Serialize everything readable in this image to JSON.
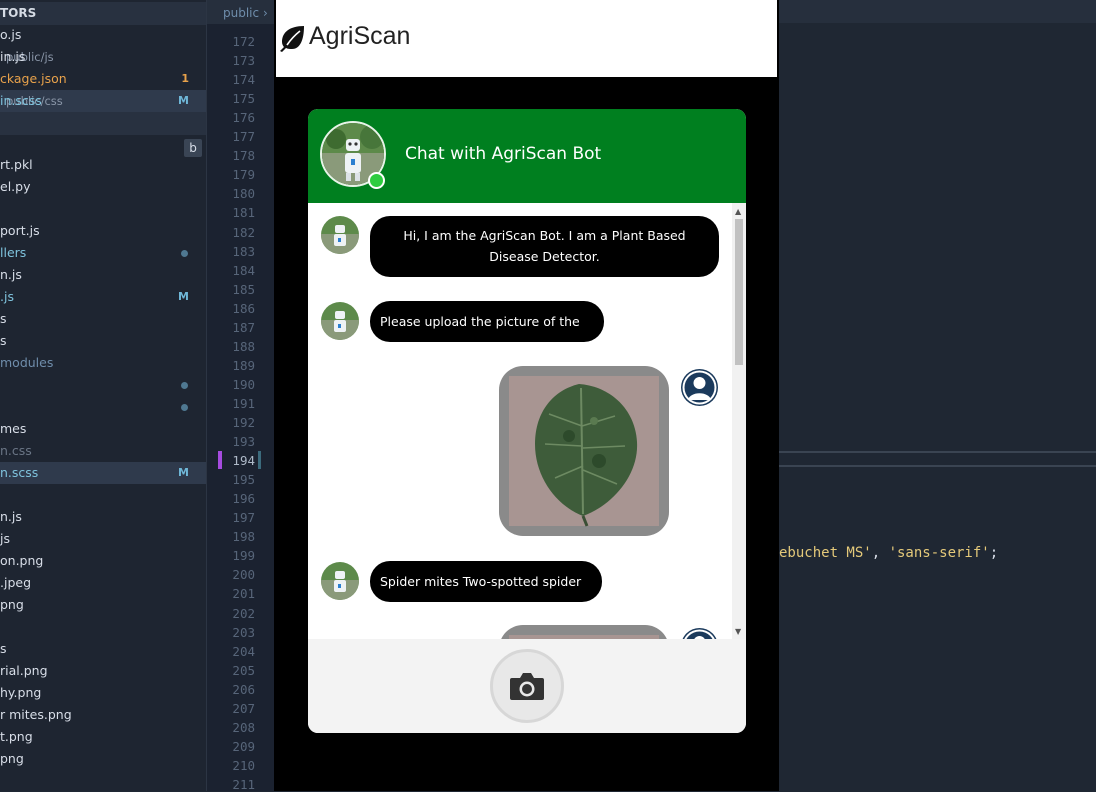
{
  "editor": {
    "sidebar": {
      "section_open_editors": "TORS",
      "section_project": "",
      "badge_button": "b",
      "open_editors": [
        {
          "name": "o.js",
          "path": "",
          "badge": "",
          "color": "default"
        },
        {
          "name": "in.js",
          "path": "public/js",
          "badge": "",
          "color": "default"
        },
        {
          "name": "ckage.json",
          "path": "",
          "badge": "1",
          "color": "orange"
        },
        {
          "name": "in.scss",
          "path": "public/css",
          "badge": "M",
          "color": "cyan"
        }
      ],
      "files": [
        {
          "name": "rt.pkl",
          "badge": "",
          "color": "default"
        },
        {
          "name": "el.py",
          "badge": "",
          "color": "default"
        },
        {
          "name": "",
          "badge": "",
          "color": "default"
        },
        {
          "name": "port.js",
          "badge": "",
          "color": "default"
        },
        {
          "name": "llers",
          "badge": "dot",
          "color": "cyan"
        },
        {
          "name": "n.js",
          "badge": "",
          "color": "default"
        },
        {
          "name": ".js",
          "badge": "M",
          "color": "cyan"
        },
        {
          "name": "s",
          "badge": "",
          "color": "default"
        },
        {
          "name": "s",
          "badge": "",
          "color": "default"
        },
        {
          "name": "modules",
          "badge": "",
          "color": "dim"
        },
        {
          "name": "",
          "badge": "dot",
          "color": "default"
        },
        {
          "name": "",
          "badge": "dot",
          "color": "default"
        },
        {
          "name": "mes",
          "badge": "",
          "color": "default"
        },
        {
          "name": "n.css",
          "badge": "",
          "color": "grey"
        },
        {
          "name": "n.scss",
          "badge": "M",
          "color": "cyan"
        },
        {
          "name": "",
          "badge": "",
          "color": "default"
        },
        {
          "name": "n.js",
          "badge": "",
          "color": "default"
        },
        {
          "name": "js",
          "badge": "",
          "color": "default"
        },
        {
          "name": "on.png",
          "badge": "",
          "color": "default"
        },
        {
          "name": ".jpeg",
          "badge": "",
          "color": "default"
        },
        {
          "name": "png",
          "badge": "",
          "color": "default"
        },
        {
          "name": "",
          "badge": "",
          "color": "default"
        },
        {
          "name": "s",
          "badge": "",
          "color": "default"
        },
        {
          "name": "rial.png",
          "badge": "",
          "color": "default"
        },
        {
          "name": "hy.png",
          "badge": "",
          "color": "default"
        },
        {
          "name": "r mites.png",
          "badge": "",
          "color": "default"
        },
        {
          "name": "t.png",
          "badge": "",
          "color": "default"
        },
        {
          "name": "png",
          "badge": "",
          "color": "default"
        }
      ]
    },
    "breadcrumb": "public",
    "line_numbers": [
      "172",
      "173",
      "174",
      "175",
      "176",
      "177",
      "178",
      "179",
      "180",
      "181",
      "182",
      "183",
      "184",
      "185",
      "186",
      "187",
      "188",
      "189",
      "190",
      "191",
      "192",
      "193",
      "194",
      "195",
      "196",
      "197",
      "198",
      "199",
      "200",
      "201",
      "202",
      "203",
      "204",
      "205",
      "206",
      "207",
      "208",
      "209",
      "210",
      "211"
    ],
    "code_fragment": {
      "a": "ebuchet MS'",
      "sep": ", ",
      "b": "'sans-serif'",
      "end": ";"
    }
  },
  "app": {
    "brand": "AgriScan",
    "chat_title": "Chat with AgriScan Bot",
    "messages": [
      {
        "from": "bot",
        "type": "text",
        "text": "Hi, I am the AgriScan Bot. I am a Plant Based Disease Detector."
      },
      {
        "from": "bot",
        "type": "text",
        "text": "Please upload the picture of the crop."
      },
      {
        "from": "user",
        "type": "image",
        "icon": "leaf-photo"
      },
      {
        "from": "bot",
        "type": "text",
        "text": "Spider mites Two-spotted spider mite"
      },
      {
        "from": "user",
        "type": "image",
        "icon": "leaf-photo"
      }
    ],
    "upload_icon": "camera-icon",
    "colors": {
      "header": "#007f1f",
      "bubble": "#000000",
      "online": "#2ecc40"
    }
  }
}
